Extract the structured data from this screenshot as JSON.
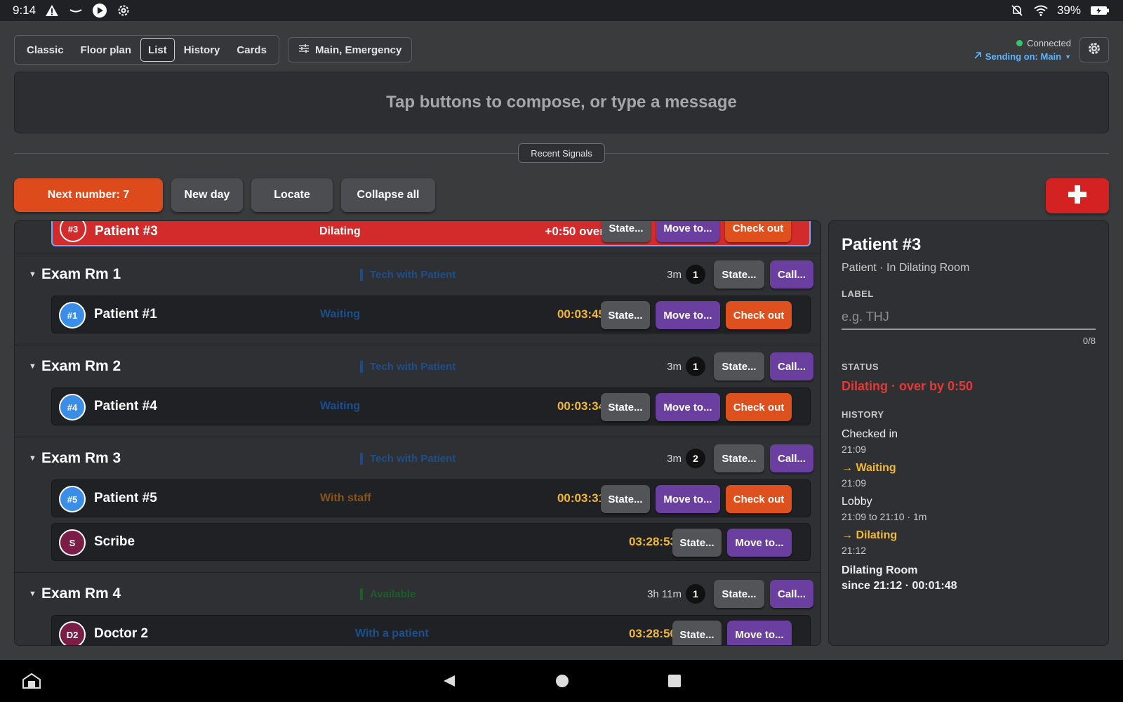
{
  "status_bar": {
    "time": "9:14",
    "battery": "39%"
  },
  "view_tabs": [
    "Classic",
    "Floor plan",
    "List",
    "History",
    "Cards"
  ],
  "active_tab": "List",
  "filter_label": "Main, Emergency",
  "connection": {
    "status": "Connected",
    "sending": "Sending on: Main"
  },
  "compose_placeholder": "Tap buttons to compose, or type a message",
  "recent_signals": "Recent Signals",
  "actions": {
    "next_number": "Next number: 7",
    "new_day": "New day",
    "locate": "Locate",
    "collapse_all": "Collapse all"
  },
  "highlight_row": {
    "badge": "#3",
    "name": "Patient #3",
    "status": "Dilating",
    "over": "+0:50 over",
    "state": "State...",
    "move": "Move to...",
    "checkout": "Check out"
  },
  "rooms": [
    {
      "name": "Exam Rm 1",
      "status": "Tech with Patient",
      "time": "3m",
      "count": "1",
      "state": "State...",
      "call": "Call...",
      "rows": [
        {
          "badge": "#1",
          "name": "Patient #1",
          "status": "Waiting",
          "timer": "00:03:45",
          "state": "State...",
          "move": "Move to...",
          "checkout": "Check out"
        }
      ]
    },
    {
      "name": "Exam Rm 2",
      "status": "Tech with Patient",
      "time": "3m",
      "count": "1",
      "state": "State...",
      "call": "Call...",
      "rows": [
        {
          "badge": "#4",
          "name": "Patient #4",
          "status": "Waiting",
          "timer": "00:03:34",
          "state": "State...",
          "move": "Move to...",
          "checkout": "Check out"
        }
      ]
    },
    {
      "name": "Exam Rm 3",
      "status": "Tech with Patient",
      "time": "3m",
      "count": "2",
      "state": "State...",
      "call": "Call...",
      "rows": [
        {
          "badge": "#5",
          "name": "Patient #5",
          "status": "With staff",
          "timer": "00:03:31",
          "state": "State...",
          "move": "Move to...",
          "checkout": "Check out"
        },
        {
          "badge": "S",
          "name": "Scribe",
          "timer": "03:28:53",
          "state": "State...",
          "move": "Move to..."
        }
      ]
    },
    {
      "name": "Exam Rm 4",
      "status": "Available",
      "time": "3h 11m",
      "count": "1",
      "state": "State...",
      "call": "Call...",
      "rows": [
        {
          "badge": "D2",
          "name": "Doctor 2",
          "status": "With a patient",
          "timer": "03:28:50",
          "state": "State...",
          "move": "Move to..."
        }
      ]
    }
  ],
  "detail": {
    "title": "Patient #3",
    "subtitle": "Patient · In Dilating Room",
    "label_heading": "LABEL",
    "label_placeholder": "e.g. THJ",
    "label_counter": "0/8",
    "status_heading": "STATUS",
    "status_value": "Dilating · over by 0:50",
    "history_heading": "HISTORY",
    "history": [
      {
        "title": "Checked in",
        "time": "21:09"
      },
      {
        "title": "→ Waiting",
        "time": "21:09"
      },
      {
        "title": "Lobby",
        "time": "21:09 to 21:10 · 1m"
      },
      {
        "title": "→ Dilating",
        "time": "21:12"
      }
    ],
    "current_room": "Dilating Room",
    "current_since": "since 21:12 · 00:01:48"
  },
  "colors": {
    "accent_orange": "#dd4a1c",
    "alert_red": "#d32b2b",
    "purple": "#6a3fa0",
    "timer_yellow": "#f1b934",
    "link_blue": "#5fb4ff"
  }
}
